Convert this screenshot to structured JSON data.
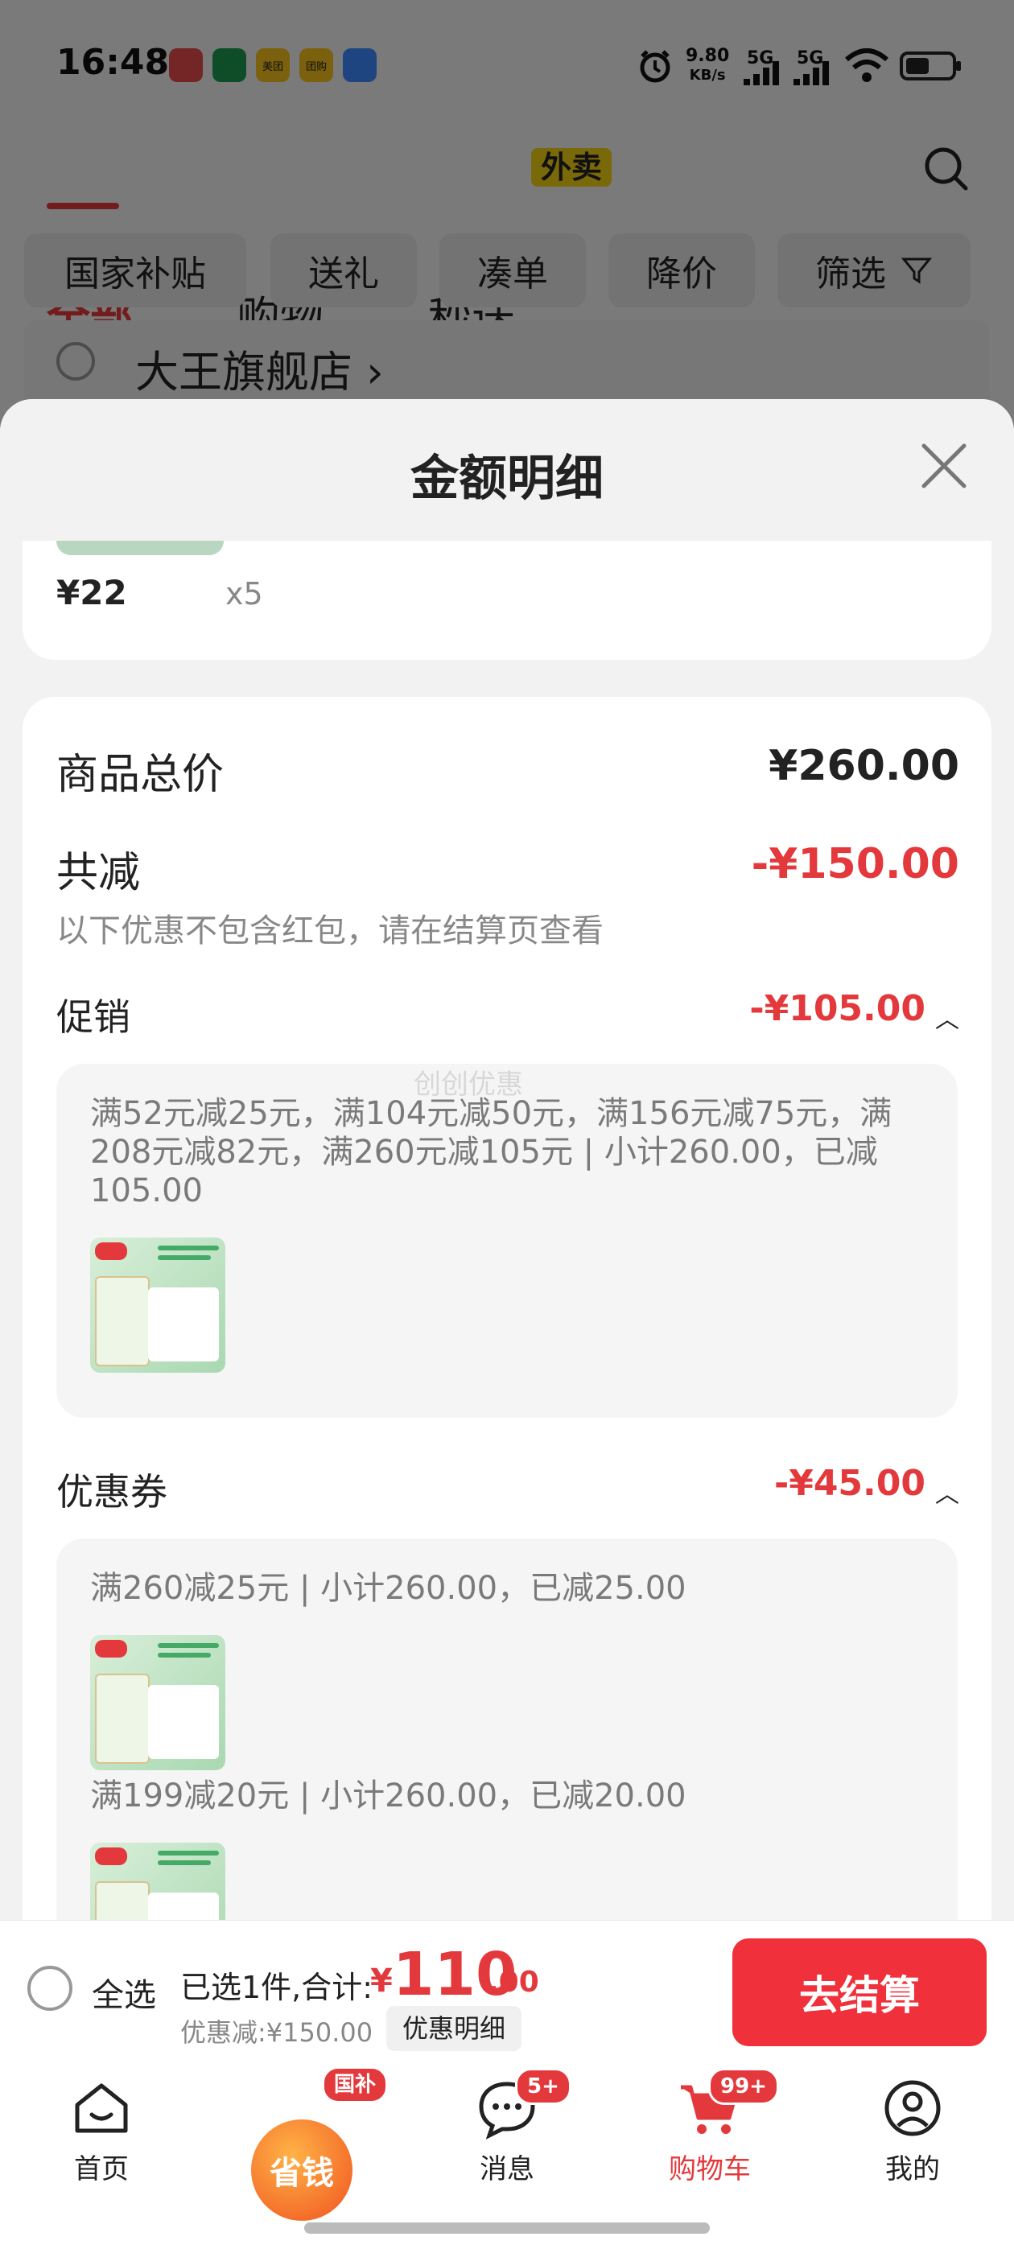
{
  "status": {
    "time": "16:48",
    "net_speed_value": "9.80",
    "net_speed_unit": "KB/s",
    "signal1": "5G",
    "signal2": "5G",
    "app_icons": [
      "app-icon-1",
      "app-icon-2",
      "meituan-icon",
      "tuanhao-icon",
      "app-icon-5"
    ],
    "app_icon_labels": [
      "",
      "",
      "美团",
      "团购",
      ""
    ]
  },
  "header": {
    "tabs": [
      "全部",
      "购物",
      "秒送"
    ],
    "takeout_badge": "外卖",
    "filters": [
      "国家补贴",
      "送礼",
      "凑单",
      "降价",
      "筛选"
    ],
    "store_name": "大王旗舰店"
  },
  "sheet": {
    "title": "金额明细",
    "prev_item": {
      "price": "¥22",
      "qty": "x5"
    },
    "goods_total_label": "商品总价",
    "goods_total_value": "¥260.00",
    "reduction_label": "共减",
    "reduction_value": "-¥150.00",
    "reduction_note": "以下优惠不包含红包，请在结算页查看",
    "promo_label": "促销",
    "promo_value": "-¥105.00",
    "promo_detail": "满52元减25元，满104元减50元，满156元减75元，满208元减82元，满260元减105元 | 小计260.00，已减105.00",
    "coupon_label": "优惠券",
    "coupon_value": "-¥45.00",
    "coupon_details": [
      "满260减25元 | 小计260.00，已减25.00",
      "满199减20元 | 小计260.00，已减20.00"
    ],
    "watermark": "创创优惠"
  },
  "checkout": {
    "select_all": "全选",
    "selected_text": "已选1件,合计:",
    "currency": "¥",
    "total_int": "110",
    "total_dec": ".00",
    "discount_text": "优惠减:¥150.00",
    "detail_button": "优惠明细",
    "pay_button": "去结算"
  },
  "tabbar": {
    "items": [
      "首页",
      "省钱",
      "消息",
      "购物车",
      "我的"
    ],
    "save_badge": "国补",
    "message_badge": "5+",
    "cart_badge": "99+"
  },
  "colors": {
    "accent": "#e4393c",
    "pay_button": "#f0303a",
    "takeout_badge": "#f5d312"
  }
}
